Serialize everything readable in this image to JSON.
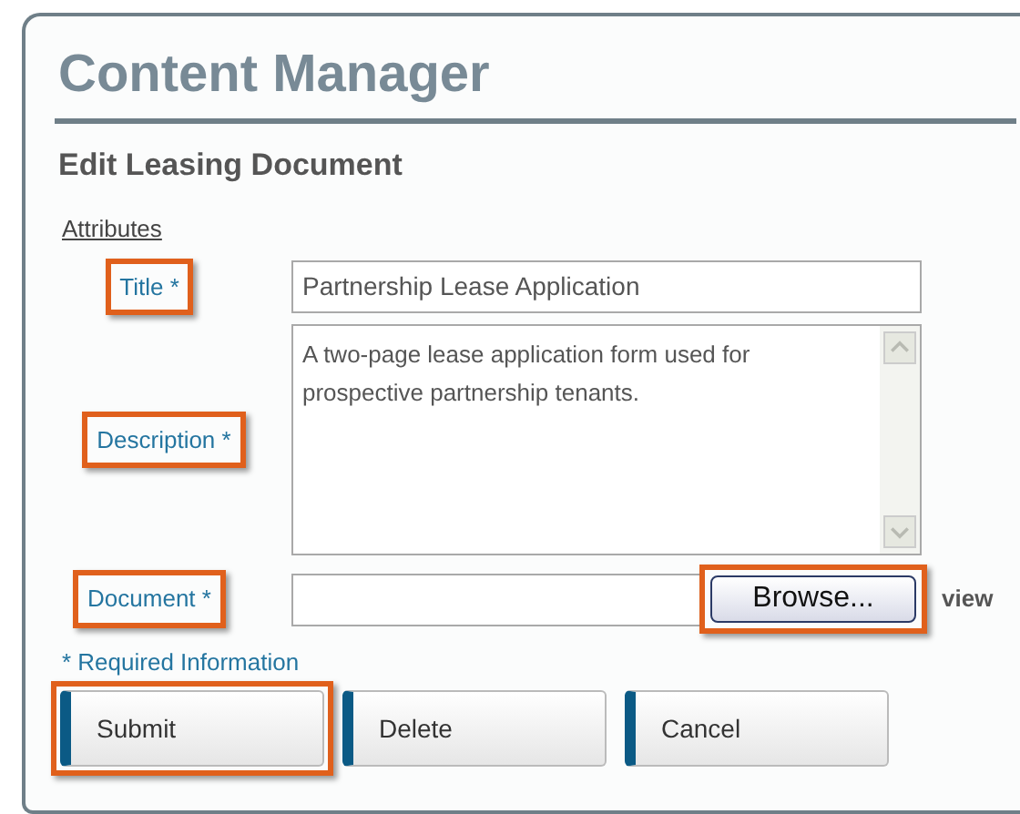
{
  "header": {
    "title": "Content Manager",
    "subtitle": "Edit Leasing Document"
  },
  "section_link": "Attributes",
  "fields": [
    {
      "kind": "text",
      "label": "Title *",
      "value": "Partnership Lease Application",
      "highlighted": true
    },
    {
      "kind": "textarea",
      "label": "Description *",
      "value": "A two-page lease application form used for prospective partnership tenants.",
      "highlighted": true
    },
    {
      "kind": "file",
      "label": "Document *",
      "button": "Browse...",
      "button_highlighted": true,
      "link": "view",
      "highlighted": true
    }
  ],
  "required_note": "* Required Information",
  "buttons": [
    {
      "label": "Submit",
      "highlighted": true
    },
    {
      "label": "Delete",
      "highlighted": false
    },
    {
      "label": "Cancel",
      "highlighted": false
    }
  ]
}
